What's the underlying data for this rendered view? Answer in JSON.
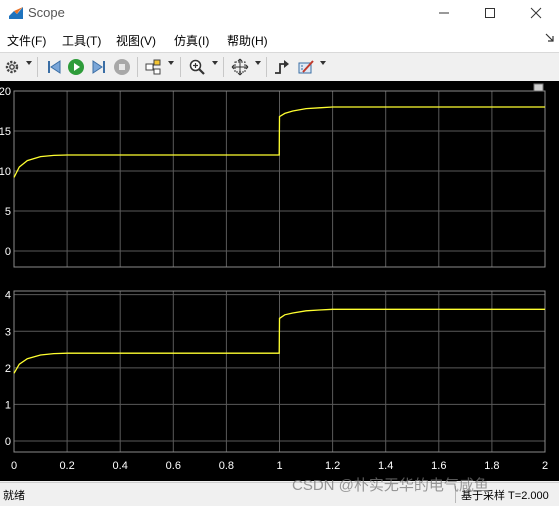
{
  "window": {
    "title": "Scope",
    "icon": "matlab-scope-icon",
    "controls": [
      "minimize-icon",
      "maximize-icon",
      "close-icon"
    ]
  },
  "menu": {
    "items": [
      "文件(F)",
      "工具(T)",
      "视图(V)",
      "仿真(I)",
      "帮助(H)"
    ],
    "pin_icon": "undock-arrow-icon"
  },
  "toolbar": {
    "buttons": [
      "settings-gear-icon",
      "step-back-icon",
      "run-icon",
      "step-forward-icon",
      "stop-icon",
      "highlight-block-icon",
      "zoom-icon",
      "fit-axes-icon",
      "triggers-icon",
      "measurements-icon"
    ]
  },
  "colors": {
    "plot_background": "#000000",
    "grid": "#5a5a5a",
    "signal": "#ffff30",
    "axis_text": "#ffffff"
  },
  "status": {
    "ready": "就绪",
    "sample_info": "基于采样  T=2.000",
    "watermark": "CSDN @朴实无华的电气咸鱼"
  },
  "chart_data": [
    {
      "type": "line",
      "x": [
        0,
        0.02,
        0.05,
        0.1,
        0.15,
        0.2,
        0.3,
        0.4,
        0.5,
        0.6,
        0.7,
        0.8,
        0.9,
        0.999,
        1.0,
        1.02,
        1.05,
        1.1,
        1.15,
        1.2,
        1.3,
        1.4,
        1.5,
        1.6,
        1.7,
        1.8,
        1.9,
        2.0
      ],
      "series": [
        {
          "values": [
            9.2,
            10.5,
            11.3,
            11.8,
            11.95,
            12.0,
            12.0,
            12.0,
            12.0,
            12.0,
            12.0,
            12.0,
            12.0,
            12.0,
            16.8,
            17.2,
            17.5,
            17.8,
            17.9,
            18.0,
            18.0,
            18.0,
            18.0,
            18.0,
            18.0,
            18.0,
            18.0,
            18.0
          ]
        }
      ],
      "xlim": [
        0,
        2
      ],
      "ylim": [
        -2,
        20
      ],
      "yticks": [
        0,
        5,
        10,
        15,
        20
      ],
      "yticklabels": [
        "0",
        "5",
        "10",
        "15",
        "20"
      ],
      "grid": true
    },
    {
      "type": "line",
      "x": [
        0,
        0.02,
        0.05,
        0.1,
        0.15,
        0.2,
        0.3,
        0.4,
        0.5,
        0.6,
        0.7,
        0.8,
        0.9,
        0.999,
        1.0,
        1.02,
        1.05,
        1.1,
        1.15,
        1.2,
        1.3,
        1.4,
        1.5,
        1.6,
        1.7,
        1.8,
        1.9,
        2.0
      ],
      "series": [
        {
          "values": [
            1.85,
            2.1,
            2.25,
            2.35,
            2.39,
            2.4,
            2.4,
            2.4,
            2.4,
            2.4,
            2.4,
            2.4,
            2.4,
            2.4,
            3.35,
            3.45,
            3.5,
            3.56,
            3.58,
            3.6,
            3.6,
            3.6,
            3.6,
            3.6,
            3.6,
            3.6,
            3.6,
            3.6
          ]
        }
      ],
      "xlim": [
        0,
        2
      ],
      "ylim": [
        -0.3,
        4.1
      ],
      "yticks": [
        0,
        1,
        2,
        3,
        4
      ],
      "yticklabels": [
        "0",
        "1",
        "2",
        "3",
        "4"
      ],
      "xticks": [
        0,
        0.2,
        0.4,
        0.6,
        0.8,
        1,
        1.2,
        1.4,
        1.6,
        1.8,
        2
      ],
      "xticklabels": [
        "0",
        "0.2",
        "0.4",
        "0.6",
        "0.8",
        "1",
        "1.2",
        "1.4",
        "1.6",
        "1.8",
        "2"
      ],
      "grid": true
    }
  ]
}
